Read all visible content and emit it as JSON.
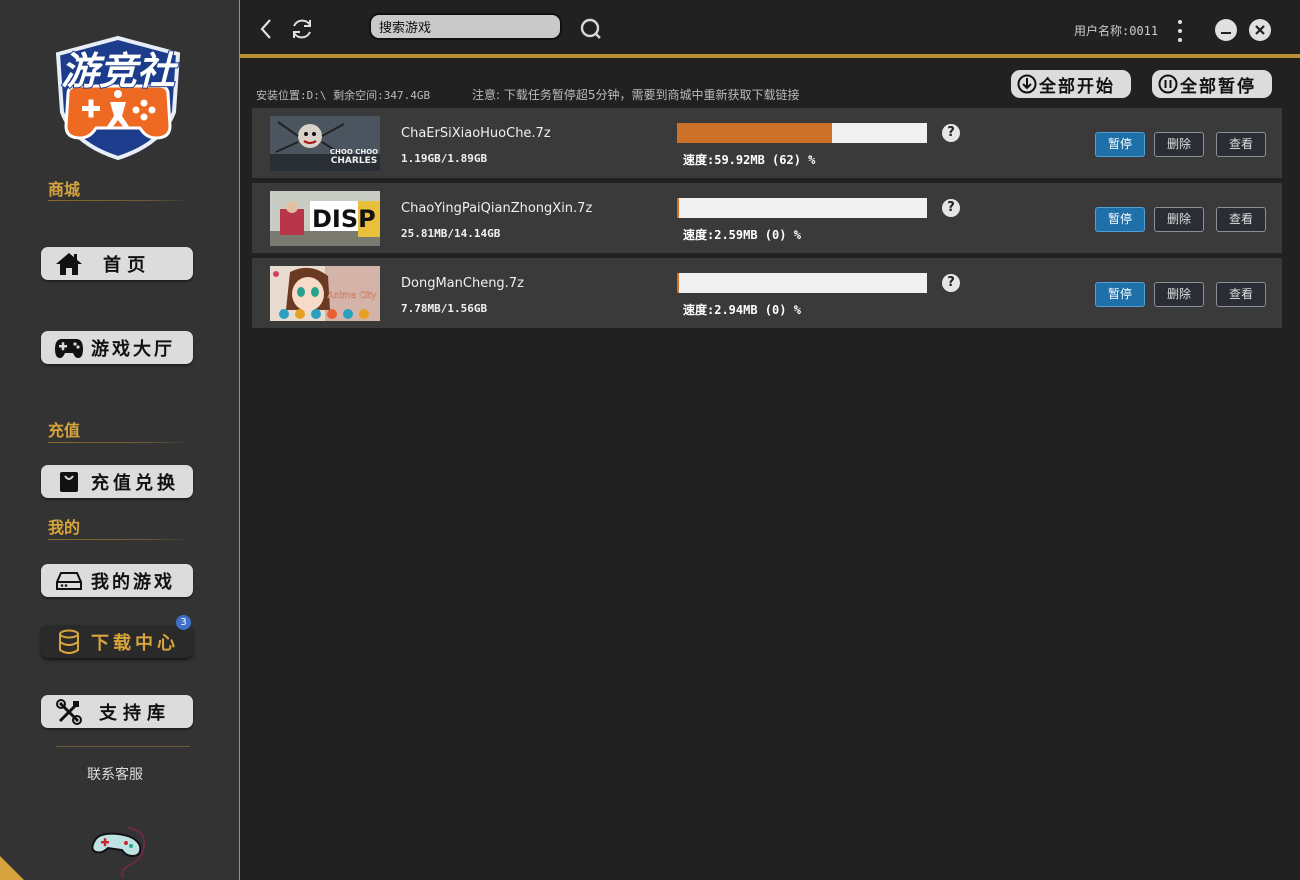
{
  "sidebar": {
    "logo_text": "游竞社",
    "sections": {
      "shop": "商城",
      "recharge": "充值",
      "mine": "我的"
    },
    "items": [
      {
        "label": "首 页",
        "icon": "home-icon"
      },
      {
        "label": "游戏大厅",
        "icon": "gamepad-icon"
      },
      {
        "label": "充值兑换",
        "icon": "shopping-bag-icon"
      },
      {
        "label": "我的游戏",
        "icon": "drive-icon"
      },
      {
        "label": "下载中心",
        "icon": "database-icon",
        "active": true,
        "badge": "3"
      },
      {
        "label": "支持库",
        "icon": "tools-icon"
      }
    ],
    "contact": "联系客服"
  },
  "topbar": {
    "search_value": "搜索游戏",
    "username": "用户名称:0011"
  },
  "info": {
    "install": "安装位置:D:\\ 剩余空间:347.4GB",
    "notice": "注意: 下载任务暂停超5分钟，需要到商城中重新获取下载链接",
    "start_all": "全部开始",
    "pause_all": "全部暂停"
  },
  "downloads": [
    {
      "name": "ChaErSiXiaoHuoChe.7z",
      "size": "1.19GB/1.89GB",
      "speed": "速度:59.92MB (62) %",
      "progress": 0.62
    },
    {
      "name": "ChaoYingPaiQianZhongXin.7z",
      "size": "25.81MB/14.14GB",
      "speed": "速度:2.59MB (0) %",
      "progress": 0.005
    },
    {
      "name": "DongManCheng.7z",
      "size": "7.78MB/1.56GB",
      "speed": "速度:2.94MB (0) %",
      "progress": 0.005
    }
  ],
  "thumb_text": {
    "t1a": "CHOO CHOO",
    "t1b": "CHARLES",
    "t2": "DISP",
    "t3": "Anime City"
  },
  "row_buttons": {
    "pause": "暂停",
    "delete": "删除",
    "view": "查看"
  },
  "colors": {
    "accent": "#d6a43c",
    "progress": "#cd7028",
    "pause_btn": "#1f6fa8"
  }
}
